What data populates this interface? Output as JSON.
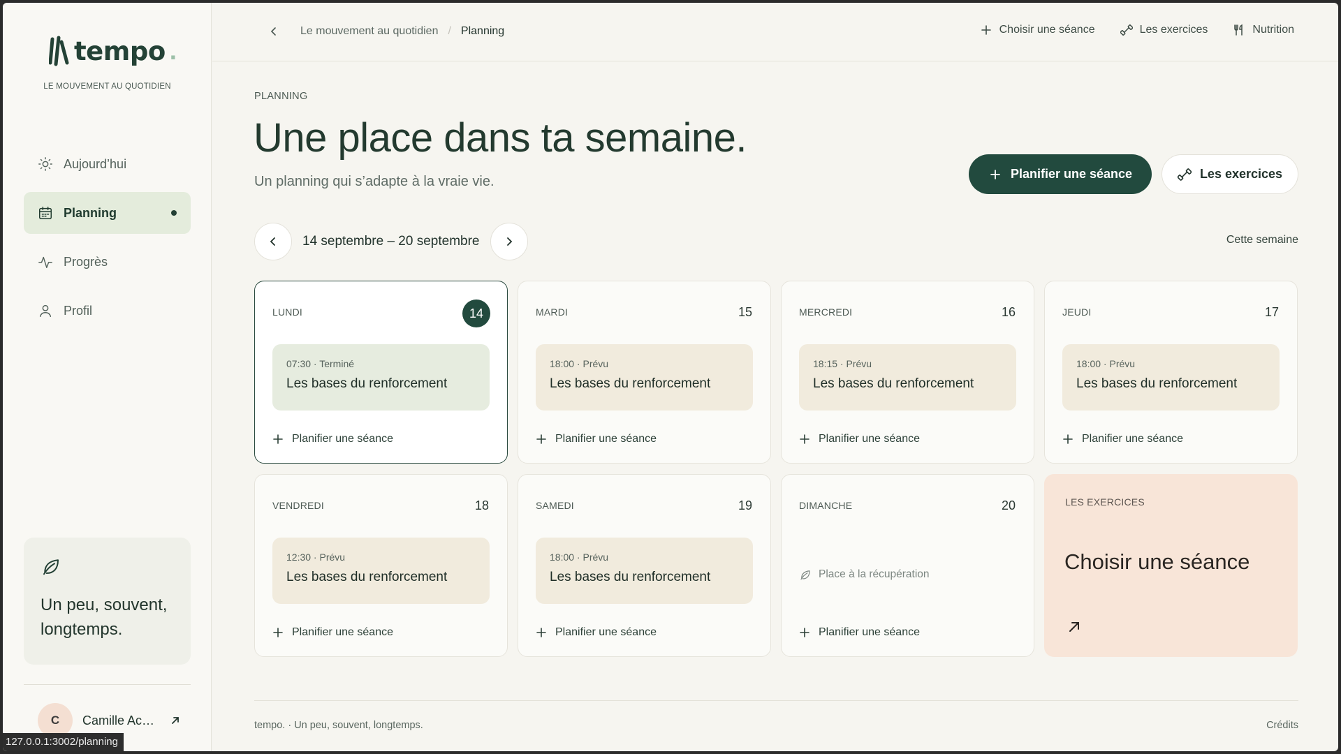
{
  "brand": {
    "name": "tempo",
    "dot": ".",
    "tagline": "LE MOUVEMENT AU QUOTIDIEN",
    "accent": "#224a3e"
  },
  "sidebar": {
    "items": [
      {
        "label": "Aujourd’hui",
        "icon": "sun-icon",
        "active": false
      },
      {
        "label": "Planning",
        "icon": "calendar-icon",
        "active": true
      },
      {
        "label": "Progrès",
        "icon": "activity-icon",
        "active": false
      },
      {
        "label": "Profil",
        "icon": "user-icon",
        "active": false
      }
    ],
    "motto": "Un peu, souvent, longtemps.",
    "user": {
      "initial": "C",
      "name": "Camille Ac…"
    }
  },
  "status_url": "127.0.0.1:3002/planning",
  "topbar": {
    "breadcrumb_parent": "Le mouvement au quotidien",
    "breadcrumb_sep": "/",
    "breadcrumb_current": "Planning",
    "actions": [
      {
        "label": "Choisir une séance",
        "icon": "plus-icon"
      },
      {
        "label": "Les exercices",
        "icon": "dumbbell-icon"
      },
      {
        "label": "Nutrition",
        "icon": "utensils-icon"
      }
    ]
  },
  "main": {
    "eyebrow": "PLANNING",
    "title": "Une place dans ta semaine.",
    "subtitle": "Un planning qui s’adapte à la vraie vie.",
    "primary_button": "Planifier une séance",
    "secondary_button": "Les exercices",
    "week_range": "14 septembre – 20 septembre",
    "this_week": "Cette semaine",
    "plan_label": "Planifier une séance",
    "days": [
      {
        "name": "LUNDI",
        "num": "14",
        "today": true,
        "session": {
          "meta": "07:30 · Terminé",
          "title": "Les bases du renforcement",
          "done": true
        }
      },
      {
        "name": "MARDI",
        "num": "15",
        "today": false,
        "session": {
          "meta": "18:00 · Prévu",
          "title": "Les bases du renforcement",
          "done": false
        }
      },
      {
        "name": "MERCREDI",
        "num": "16",
        "today": false,
        "session": {
          "meta": "18:15 · Prévu",
          "title": "Les bases du renforcement",
          "done": false
        }
      },
      {
        "name": "JEUDI",
        "num": "17",
        "today": false,
        "session": {
          "meta": "18:00 · Prévu",
          "title": "Les bases du renforcement",
          "done": false
        }
      },
      {
        "name": "VENDREDI",
        "num": "18",
        "today": false,
        "session": {
          "meta": "12:30 · Prévu",
          "title": "Les bases du renforcement",
          "done": false
        }
      },
      {
        "name": "SAMEDI",
        "num": "19",
        "today": false,
        "session": {
          "meta": "18:00 · Prévu",
          "title": "Les bases du renforcement",
          "done": false
        }
      },
      {
        "name": "DIMANCHE",
        "num": "20",
        "today": false,
        "session": null,
        "recovery": "Place à la récupération"
      }
    ],
    "exercises_card": {
      "eyebrow": "LES EXERCICES",
      "title": "Choisir une séance"
    }
  },
  "footer": {
    "left": "tempo. · Un peu, souvent, longtemps.",
    "right": "Crédits"
  }
}
